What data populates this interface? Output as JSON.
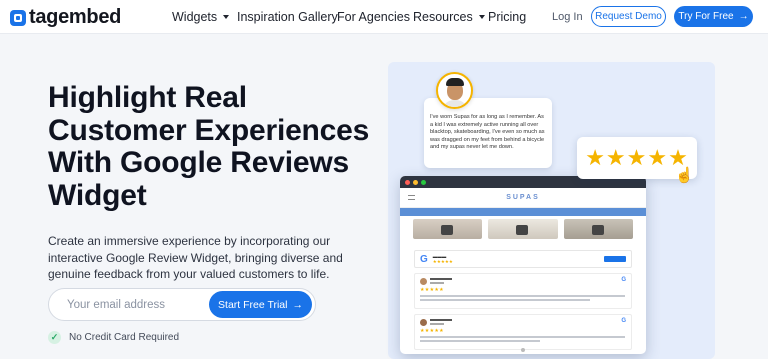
{
  "header": {
    "logo_text": "tagembed",
    "nav": [
      {
        "label": "Widgets",
        "has_dropdown": true
      },
      {
        "label": "Inspiration Gallery",
        "has_dropdown": false
      },
      {
        "label": "For Agencies",
        "has_dropdown": false
      },
      {
        "label": "Resources",
        "has_dropdown": true
      },
      {
        "label": "Pricing",
        "has_dropdown": false
      }
    ],
    "login_label": "Log In",
    "demo_label": "Request Demo",
    "try_label": "Try For Free"
  },
  "hero": {
    "title": "Highlight Real Customer Experiences With Google Reviews Widget",
    "subtitle": "Create an immersive experience by incorporating our interactive Google Review Widget, bringing diverse and genuine feedback from your valued customers to life.",
    "email_placeholder": "Your email address",
    "cta_label": "Start Free Trial",
    "no_card_label": "No Credit Card Required"
  },
  "illustration": {
    "quote_text": "I've worn Supas for as long as I remember. As a kid I was extremely active running all over blacktop, skateboarding, I've even so much as was dragged on my feet from behind a bicycle and my supas never let me down.",
    "site_logo": "SUPAS",
    "big_stars": "★★★★★",
    "review_stars": "★★★★★"
  },
  "colors": {
    "accent": "#1a73e8",
    "star": "#f5b400",
    "illustration_bg": "#e4ecfb"
  },
  "icons": [
    "logo-icon",
    "chevron-down-icon",
    "arrow-right-icon",
    "check-circle-icon",
    "star-icon",
    "hand-pointer-icon",
    "google-icon",
    "menu-icon"
  ]
}
